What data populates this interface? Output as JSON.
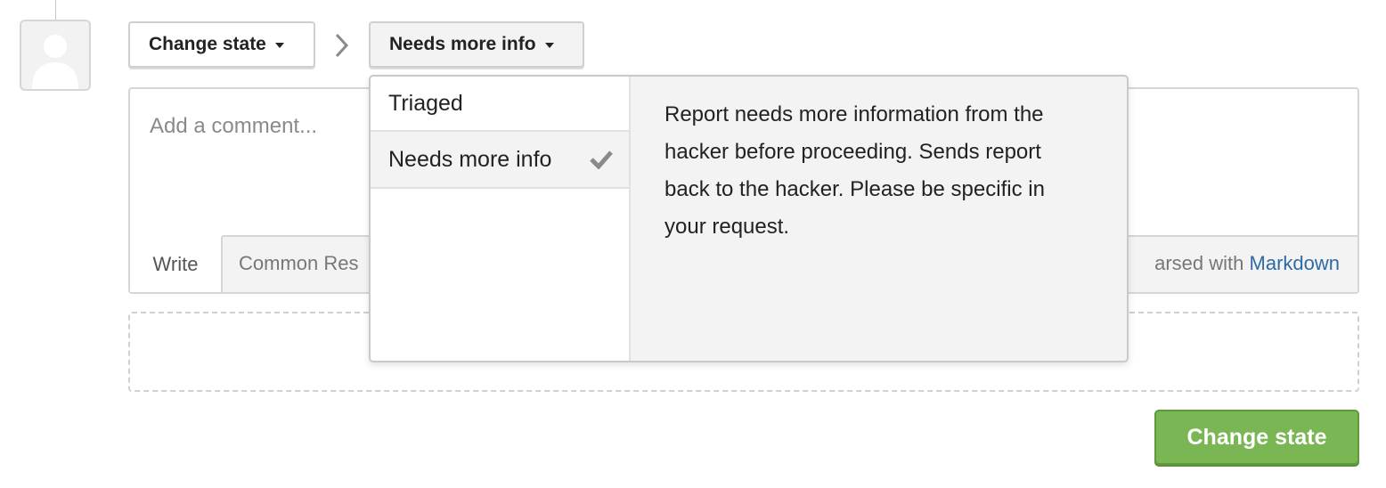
{
  "toolbar": {
    "change_state_label": "Change state",
    "selected_state_label": "Needs more info"
  },
  "comment": {
    "placeholder": "Add a comment...",
    "tab_write": "Write",
    "tab_common": "Common Res",
    "parsed_prefix": "arsed with",
    "parsed_link": "Markdown"
  },
  "dropdown": {
    "items": [
      {
        "label": "Triaged",
        "selected": false
      },
      {
        "label": "Needs more info",
        "selected": true
      }
    ],
    "description": "Report needs more information from the hacker before proceeding. Sends report back to the hacker. Please be specific in your request."
  },
  "submit": {
    "label": "Change state"
  },
  "colors": {
    "accent_green": "#7ab754",
    "link_blue": "#2f6aa5",
    "border_gray": "#d6d6d6"
  },
  "icons": {
    "avatar": "user-silhouette-icon",
    "separator": "chevron-right-icon",
    "caret": "caret-down-icon",
    "selected_mark": "checkmark-icon"
  }
}
